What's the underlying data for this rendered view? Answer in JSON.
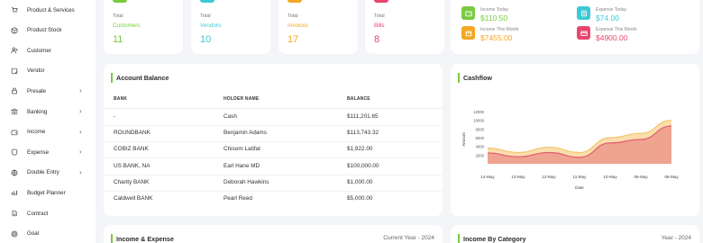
{
  "sidebar": {
    "items": [
      {
        "label": "Product & Services",
        "icon": "cart-icon",
        "chevron": false
      },
      {
        "label": "Product Stock",
        "icon": "box-icon",
        "chevron": false
      },
      {
        "label": "Customer",
        "icon": "user-plus-icon",
        "chevron": false
      },
      {
        "label": "Vendor",
        "icon": "note-icon",
        "chevron": false
      },
      {
        "label": "Presale",
        "icon": "lock-icon",
        "chevron": true
      },
      {
        "label": "Banking",
        "icon": "bank-icon",
        "chevron": true
      },
      {
        "label": "Income",
        "icon": "wallet-icon",
        "chevron": true
      },
      {
        "label": "Expense",
        "icon": "shield-icon",
        "chevron": true
      },
      {
        "label": "Double Entry",
        "icon": "globe-icon",
        "chevron": true
      },
      {
        "label": "Budget Planner",
        "icon": "chart-icon",
        "chevron": false
      },
      {
        "label": "Contract",
        "icon": "contract-icon",
        "chevron": false
      },
      {
        "label": "Goal",
        "icon": "target-icon",
        "chevron": false
      }
    ]
  },
  "stats": [
    {
      "t1": "Total",
      "t2": "Customers",
      "t3": "11",
      "color": "#7ac943"
    },
    {
      "t1": "Total",
      "t2": "Vendors",
      "t3": "10",
      "color": "#3ec9d6"
    },
    {
      "t1": "Total",
      "t2": "Invoices",
      "t3": "17",
      "color": "#f5a623"
    },
    {
      "t1": "Total",
      "t2": "Bills",
      "t3": "8",
      "color": "#e8466d"
    }
  ],
  "summary": {
    "income_today": {
      "label": "Income Today",
      "value": "$110.50",
      "color": "#7ac943"
    },
    "expense_today": {
      "label": "Expense Today",
      "value": "$74.00",
      "color": "#3ec9d6"
    },
    "income_month": {
      "label": "Income This Month",
      "value": "$7455.00",
      "color": "#f5a623"
    },
    "expense_month": {
      "label": "Expense This Month",
      "value": "$4900.00",
      "color": "#e8466d"
    }
  },
  "account_balance": {
    "title": "Account Balance",
    "headers": [
      "BANK",
      "HOLDER NAME",
      "BALANCE"
    ],
    "rows": [
      [
        "-",
        "Cash",
        "$111,201.65"
      ],
      [
        "ROUNDBANK",
        "Benjamin Adams",
        "$113,743.32"
      ],
      [
        "COBIZ BANK",
        "Chisom Latifat",
        "$1,922.00"
      ],
      [
        "US BANK, NA",
        "Earl Hane MD",
        "$100,000.00"
      ],
      [
        "Charity BANK",
        "Deborah Hawkins",
        "$1,000.00"
      ],
      [
        "Caldwell BANK",
        "Pearl Reed",
        "$5,000.00"
      ]
    ]
  },
  "cashflow": {
    "title": "Cashflow"
  },
  "chart_data": {
    "type": "area",
    "title": "",
    "xlabel": "Date",
    "ylabel": "Amount",
    "categories": [
      "14-May",
      "13-May",
      "12-May",
      "11-May",
      "10-May",
      "09-May",
      "08-May"
    ],
    "ylim": [
      0,
      12000
    ],
    "yticks": [
      2000,
      4000,
      6000,
      8000,
      10000,
      12000
    ],
    "series": [
      {
        "name": "",
        "color": "#f5c46b",
        "values": [
          3600,
          2600,
          3800,
          2600,
          6000,
          7000,
          10000
        ]
      },
      {
        "name": "",
        "color": "#e25a6e",
        "values": [
          2500,
          1600,
          2600,
          1500,
          4800,
          5600,
          8700
        ]
      }
    ]
  },
  "income_expense": {
    "title": "Income & Expense",
    "subtitle": "Current Year - 2024"
  },
  "income_by_category": {
    "title": "Income By Category",
    "subtitle": "Year - 2024"
  }
}
